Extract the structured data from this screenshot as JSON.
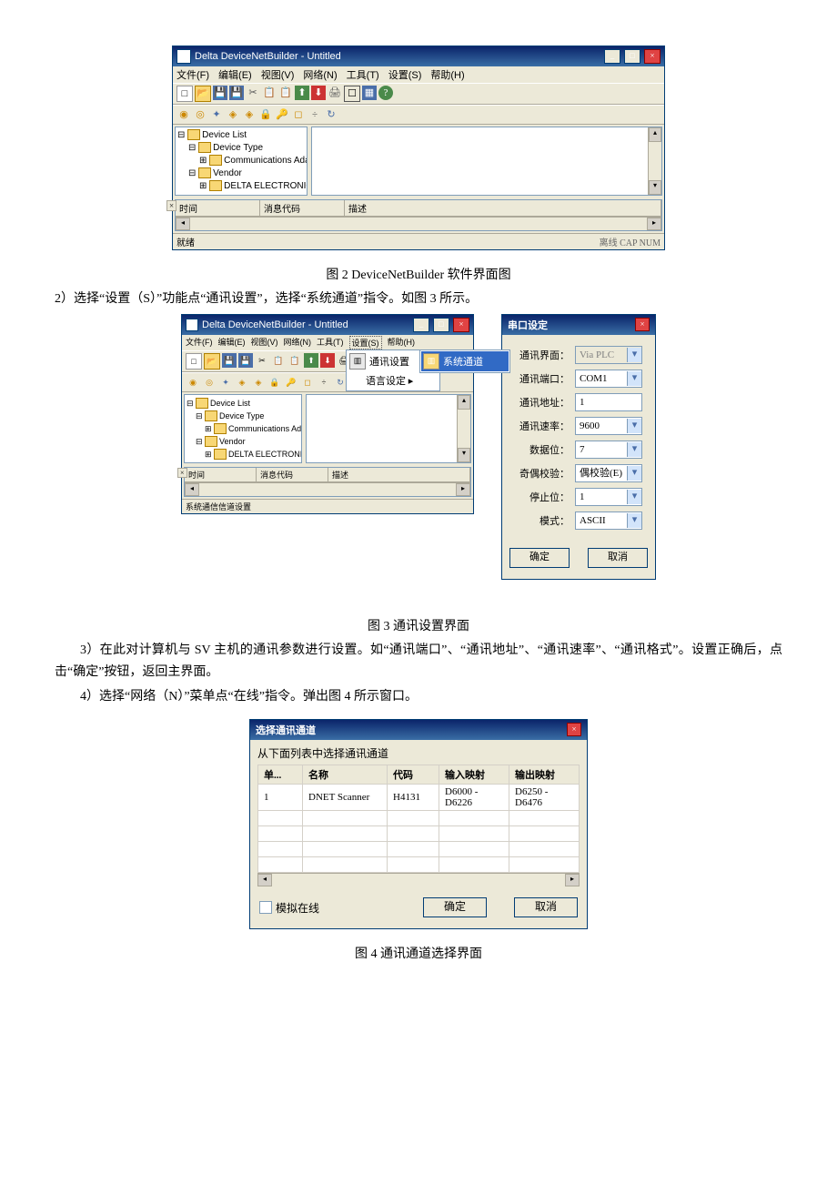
{
  "fig2": {
    "title": "Delta DeviceNetBuilder - Untitled",
    "menus": [
      "文件(F)",
      "编辑(E)",
      "视图(V)",
      "网络(N)",
      "工具(T)",
      "设置(S)",
      "帮助(H)"
    ],
    "tree": {
      "root": "Device List",
      "device_type": "Device Type",
      "comm_adapter": "Communications Adapter",
      "vendor": "Vendor",
      "delta": "DELTA ELECTRONIC, INC"
    },
    "log_headers": {
      "time": "时间",
      "code": "消息代码",
      "desc": "描述"
    },
    "status_left": "就绪",
    "status_right": "离线    CAP NUM"
  },
  "fig2_caption": "图 2 DeviceNetBuilder 软件界面图",
  "step2_text": "2）选择“设置（S）”功能点“通讯设置”，选择“系统通道”指令。如图 3 所示。",
  "fig3": {
    "title": "Delta DeviceNetBuilder - Untitled",
    "menus": [
      "文件(F)",
      "编辑(E)",
      "视图(V)",
      "网络(N)",
      "工具(T)",
      "设置(S)",
      "帮助(H)"
    ],
    "submenu": {
      "comm_set": "通讯设置",
      "lang_set": "语言设定  ▸",
      "sys_chan": "系统通道"
    },
    "tree": {
      "root": "Device List",
      "device_type": "Device Type",
      "comm_adapter": "Communications Adapter",
      "vendor": "Vendor",
      "delta": "DELTA ELECTRONIC, INC."
    },
    "log_headers": {
      "time": "时间",
      "code": "消息代码",
      "desc": "描述"
    },
    "status": "系统通信信道设置"
  },
  "serial_dlg": {
    "title": "串口设定",
    "rows": {
      "iface_l": "通讯界面：",
      "iface_v": "Via PLC",
      "port_l": "通讯端口：",
      "port_v": "COM1",
      "addr_l": "通讯地址：",
      "addr_v": "1",
      "baud_l": "通讯速率：",
      "baud_v": "9600",
      "data_l": "数据位：",
      "data_v": "7",
      "parity_l": "奇偶校验：",
      "parity_v": "偶校验(E)",
      "stop_l": "停止位：",
      "stop_v": "1",
      "mode_l": "模式：",
      "mode_v": "ASCII"
    },
    "ok": "确定",
    "cancel": "取消"
  },
  "fig3_caption": "图 3 通讯设置界面",
  "step3_text": "3）在此对计算机与 SV 主机的通讯参数进行设置。如“通讯端口”、“通讯地址”、“通讯速率”、“通讯格式”。设置正确后，点击“确定”按钮，返回主界面。",
  "step4_text": "4）选择“网络（N）”菜单点“在线”指令。弹出图 4 所示窗口。",
  "fig4": {
    "title": "选择通讯通道",
    "subtitle": "从下面列表中选择通讯通道",
    "headers": {
      "unit": "单...",
      "name": "名称",
      "code": "代码",
      "inmap": "输入映射",
      "outmap": "输出映射"
    },
    "row": {
      "unit": "1",
      "name": "DNET Scanner",
      "code": "H4131",
      "inmap": "D6000 - D6226",
      "outmap": "D6250 - D6476"
    },
    "sim": "模拟在线",
    "ok": "确定",
    "cancel": "取消"
  },
  "fig4_caption": "图 4 通讯通道选择界面"
}
